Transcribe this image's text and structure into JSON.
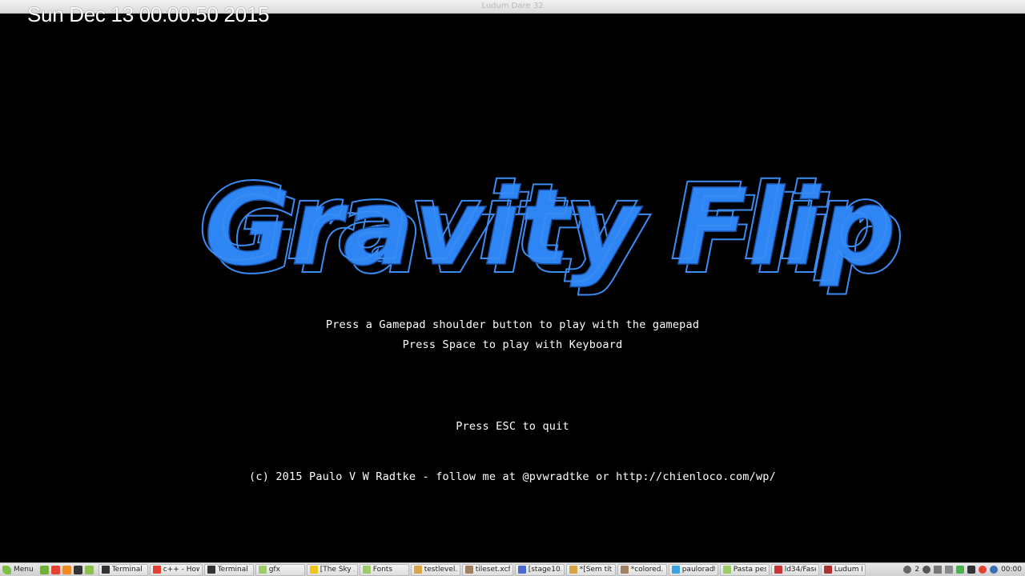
{
  "window": {
    "title": "Ludum Dare 32"
  },
  "overlay": {
    "clock": "Sun Dec 13 00:00:50 2015"
  },
  "game": {
    "logo_text": "Gravity Flip",
    "logo_color": "#2e86f5",
    "messages": {
      "gamepad": "Press a Gamepad shoulder button to play with the gamepad",
      "keyboard": "Press Space to play with Keyboard",
      "quit": "Press ESC to quit",
      "credits": "(c) 2015 Paulo V W Radtke - follow me at @pvwradtke or http://chienloco.com/wp/"
    }
  },
  "taskbar": {
    "menu_label": "Menu",
    "quick_launch": [
      {
        "icon": "show-desktop-icon",
        "color": "#6fae3a"
      },
      {
        "icon": "chrome-icon",
        "color": "#e34133"
      },
      {
        "icon": "firefox-icon",
        "color": "#f08a24"
      },
      {
        "icon": "terminal-icon",
        "color": "#333333"
      },
      {
        "icon": "files-icon",
        "color": "#8cc152"
      }
    ],
    "tasks": [
      {
        "label": "Terminal",
        "icon": "terminal-icon",
        "color": "#333333"
      },
      {
        "label": "c++ - How...",
        "icon": "chrome-icon",
        "color": "#e34133"
      },
      {
        "label": "Terminal",
        "icon": "terminal-icon",
        "color": "#333333"
      },
      {
        "label": "gfx",
        "icon": "folder-icon",
        "color": "#9ccc65"
      },
      {
        "label": "[The Sky ...",
        "icon": "editor-icon",
        "color": "#f0c419"
      },
      {
        "label": "Fonts",
        "icon": "folder-icon",
        "color": "#9ccc65"
      },
      {
        "label": "testlevel....",
        "icon": "text-file-icon",
        "color": "#d9a441"
      },
      {
        "label": "tileset.xcf...",
        "icon": "gimp-icon",
        "color": "#a08060"
      },
      {
        "label": "[stage10....",
        "icon": "tiled-icon",
        "color": "#4a6bd6"
      },
      {
        "label": "*[Sem tít...",
        "icon": "text-file-icon",
        "color": "#d9a441"
      },
      {
        "label": "*colored...",
        "icon": "gimp-icon",
        "color": "#a08060"
      },
      {
        "label": "pauloradt...",
        "icon": "twitter-icon",
        "color": "#3aa3e3"
      },
      {
        "label": "Pasta pes...",
        "icon": "folder-icon",
        "color": "#9ccc65"
      },
      {
        "label": "ld34/Fase...",
        "icon": "app-icon",
        "color": "#cc3333"
      },
      {
        "label": "Ludum D...",
        "icon": "game-window-icon",
        "color": "#b03030"
      }
    ],
    "tray": {
      "notification_count": "2",
      "time": "00:00"
    }
  }
}
